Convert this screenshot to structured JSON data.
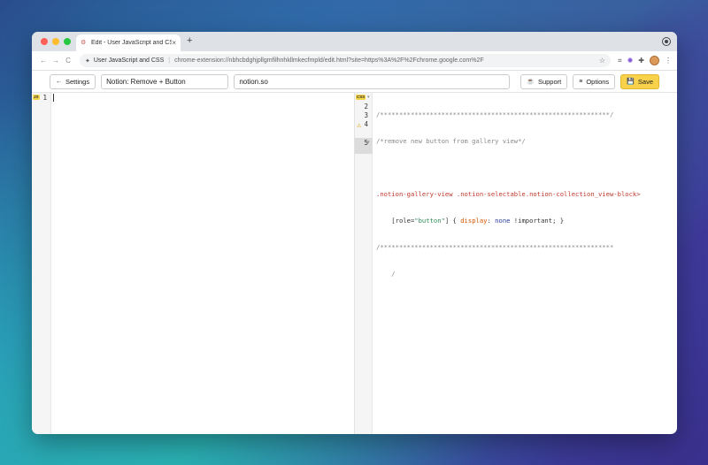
{
  "browser": {
    "tab": {
      "title": "Edit - User JavaScript and CSS",
      "close": "×",
      "favicon": "⚙"
    },
    "new_tab": "+",
    "nav": {
      "back": "←",
      "forward": "→",
      "reload": "C"
    },
    "address": {
      "site_label": "User JavaScript and CSS",
      "separator": "|",
      "url": "chrome-extension://nbhcbdghjpllgmfilhnhkllmkecfmpld/edit.html?site=https%3A%2F%2Fchrome.google.com%2F",
      "star": "☆"
    }
  },
  "toolbar": {
    "settings_label": "Settings",
    "settings_icon": "←",
    "rule_name": "Notion: Remove + Button",
    "domain": "notion.so",
    "support_label": "Support",
    "support_icon": "☕",
    "options_label": "Options",
    "options_icon": "≡",
    "save_label": "Save",
    "save_icon": "💾"
  },
  "js_editor": {
    "badge": "JS",
    "lines": [
      "1"
    ]
  },
  "css_editor": {
    "badge": "CSS",
    "line_numbers": [
      "1",
      "2",
      "3",
      "4",
      "5"
    ],
    "code": {
      "l1": "/************************************************************/",
      "l2": "/*remove new button from gallery view*/",
      "l4a_sel": ".notion-gallery-view .notion-selectable.notion-collection_view-block>",
      "l4b_open": "    [role=",
      "l4b_str": "\"button\"",
      "l4b_mid": "] { ",
      "l4b_prop": "display",
      "l4b_colon": ": ",
      "l4b_val": "none",
      "l4b_end": " !important; }",
      "l5a": "/*************************************************************",
      "l5b": "    /"
    }
  },
  "colors": {
    "save_bg": "#f8d24a",
    "badge_bg": "#f6d54a",
    "selector": "#c0392b",
    "comment": "#8a8a8a"
  }
}
